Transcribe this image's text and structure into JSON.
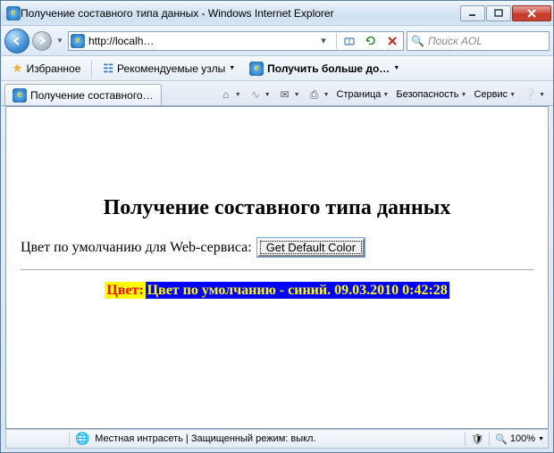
{
  "window": {
    "title": "Получение составного типа данных - Windows Internet Explorer"
  },
  "nav": {
    "url": "http://localh…",
    "search_placeholder": "Поиск AOL"
  },
  "favbar": {
    "favorites": "Избранное",
    "suggested": "Рекомендуемые узлы",
    "getmore": "Получить больше до…"
  },
  "tab": {
    "title": "Получение составного…"
  },
  "cmd": {
    "page": "Страница",
    "safety": "Безопасность",
    "service": "Сервис"
  },
  "page": {
    "heading": "Получение составного типа данных",
    "prompt": "Цвет по умолчанию для Web-сервиса:",
    "button": "Get Default Color",
    "result_label": "Цвет:",
    "result_value": "Цвет по умолчанию - синий. 09.03.2010 0:42:28"
  },
  "status": {
    "zone": "Местная интрасеть | Защищенный режим: выкл.",
    "zoom": "100%"
  }
}
